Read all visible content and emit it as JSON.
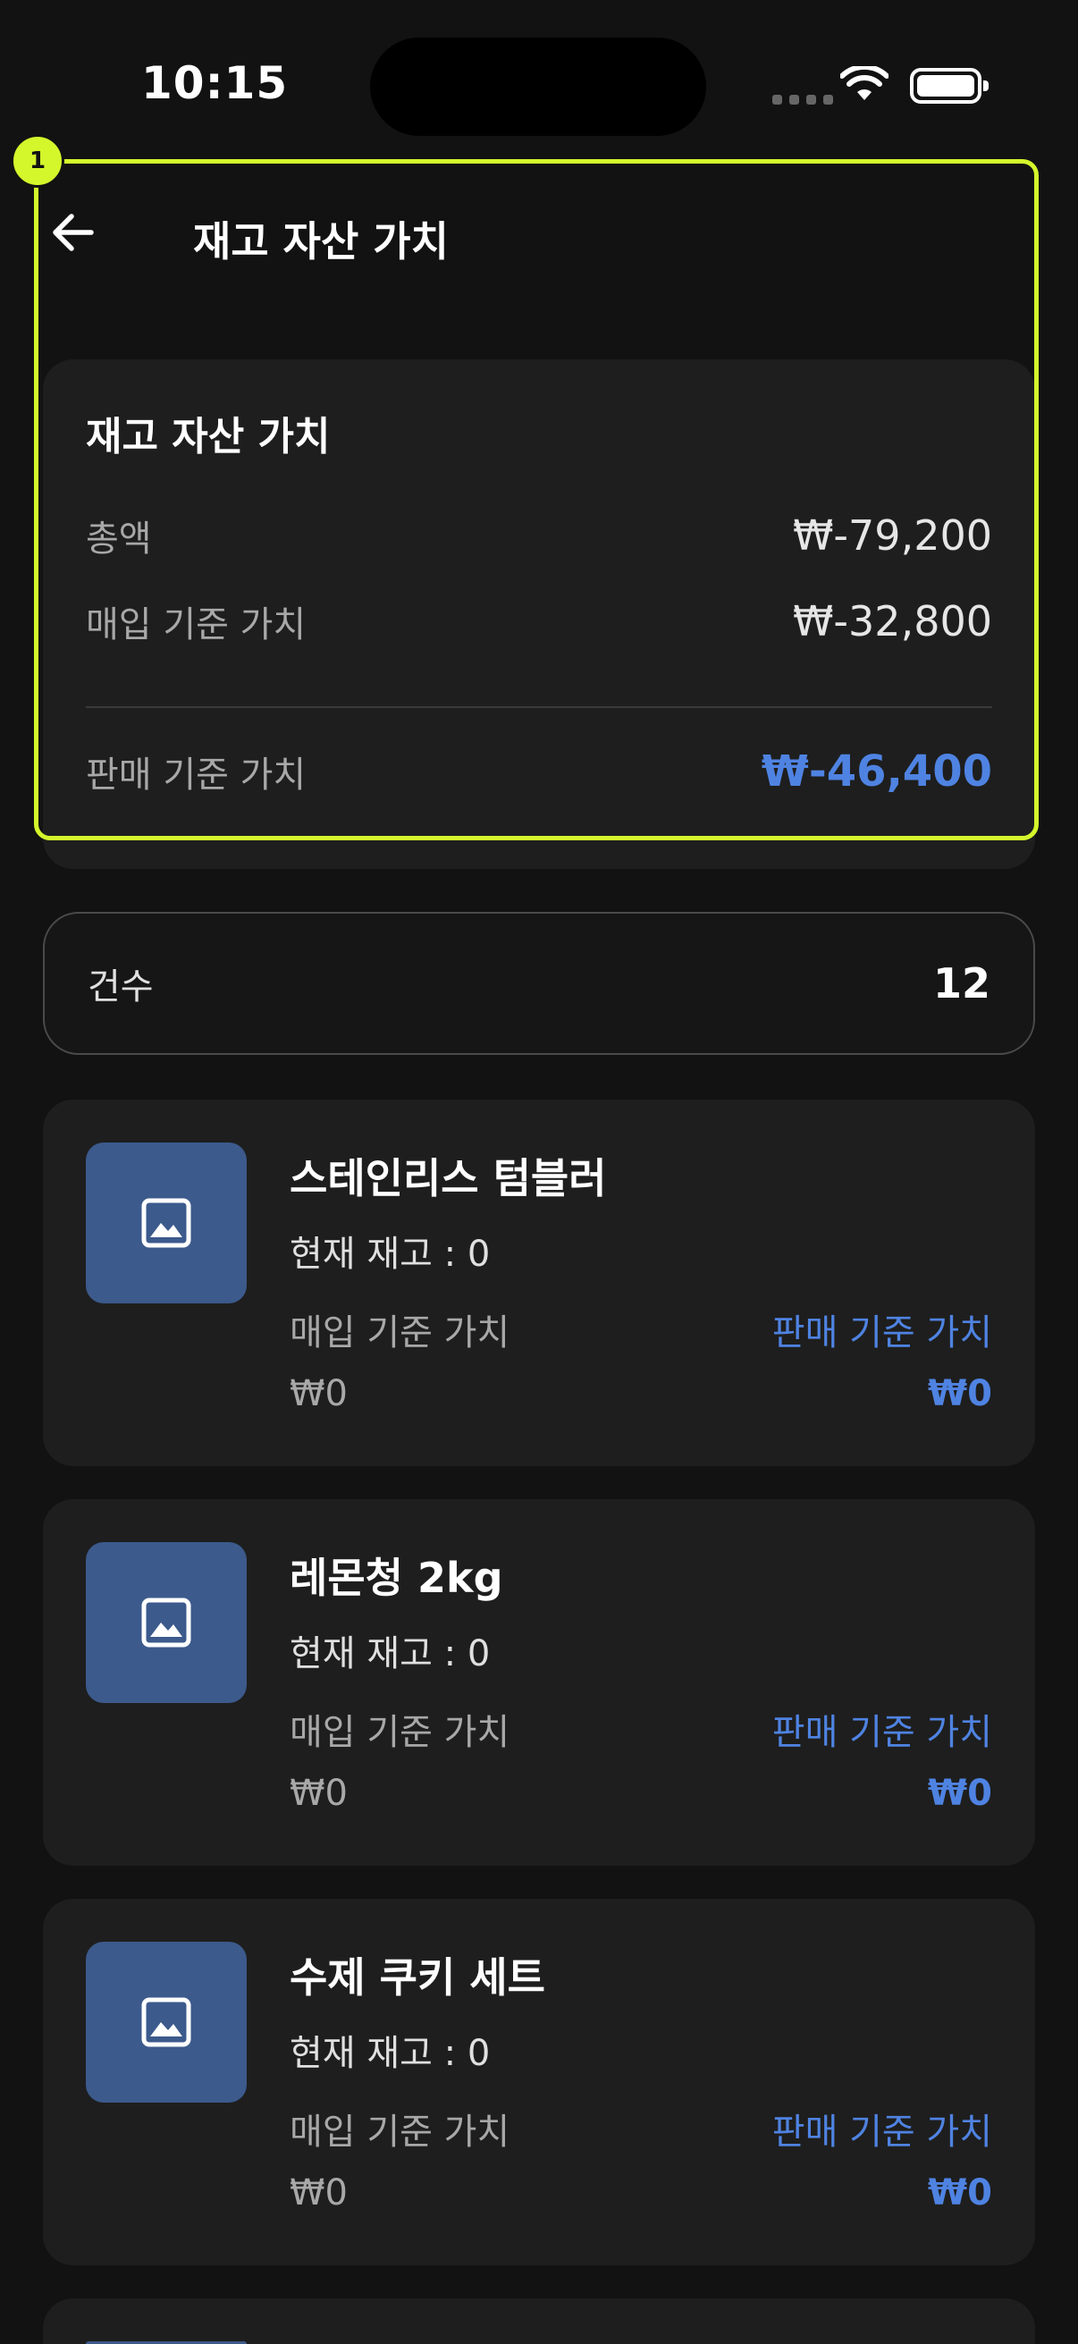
{
  "status": {
    "time": "10:15"
  },
  "header": {
    "title": "재고 자산 가치"
  },
  "summary": {
    "title": "재고 자산 가치",
    "total_label": "총액",
    "total_value": "₩-79,200",
    "purchase_label": "매입 기준 가치",
    "purchase_value": "₩-32,800",
    "sale_label": "판매 기준 가치",
    "sale_value": "₩-46,400"
  },
  "annotation": {
    "badge": "1"
  },
  "count": {
    "label": "건수",
    "value": "12"
  },
  "items": [
    {
      "name": "스테인리스 텀블러",
      "stock": "현재 재고 : 0",
      "purchase_label": "매입 기준 가치",
      "sale_label": "판매 기준 가치",
      "purchase_value": "₩0",
      "sale_value": "₩0"
    },
    {
      "name": "레몬청 2kg",
      "stock": "현재 재고 : 0",
      "purchase_label": "매입 기준 가치",
      "sale_label": "판매 기준 가치",
      "purchase_value": "₩0",
      "sale_value": "₩0"
    },
    {
      "name": "수제 쿠키 세트",
      "stock": "현재 재고 : 0",
      "purchase_label": "매입 기준 가치",
      "sale_label": "판매 기준 가치",
      "purchase_value": "₩0",
      "sale_value": "₩0"
    }
  ],
  "colors": {
    "accent": "#4f83e2",
    "highlight": "#d4f72b",
    "thumb": "#3c5a8c"
  },
  "icons": {
    "back": "arrow-left-icon",
    "thumb": "image-icon"
  }
}
